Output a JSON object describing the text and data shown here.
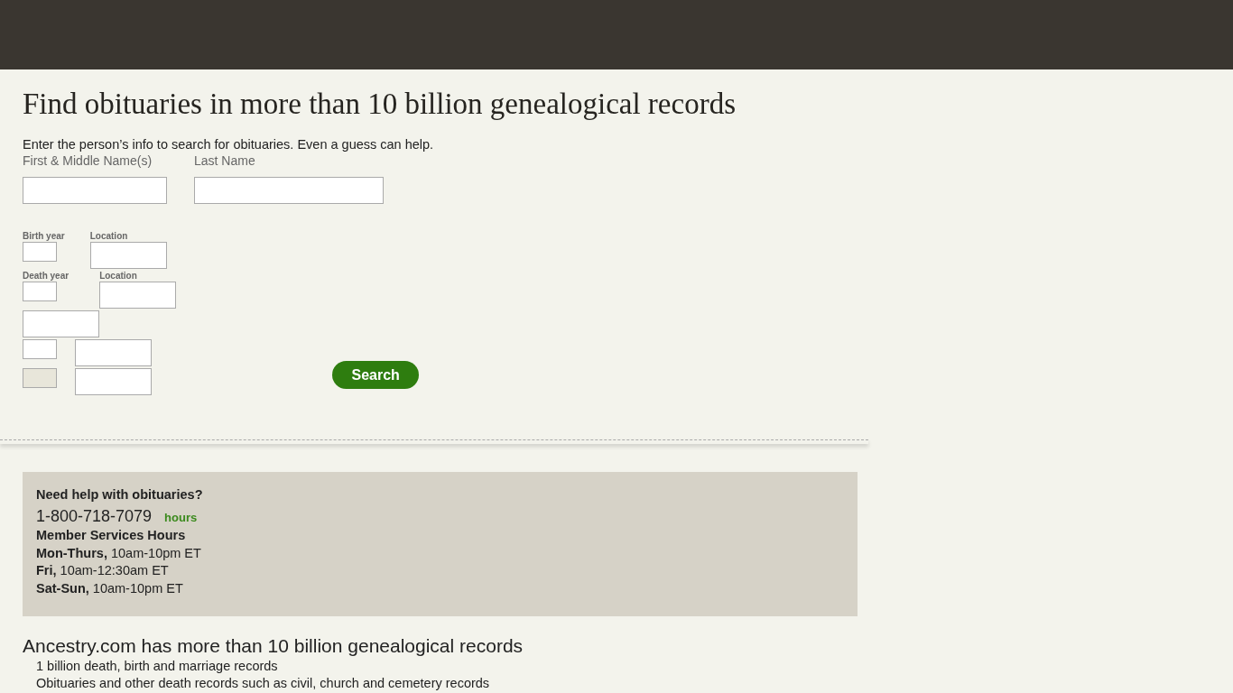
{
  "heading": "Find obituaries in more than 10 billion genealogical records",
  "intro": "Enter the person’s info to search for obituaries. Even a guess can help.",
  "name_fields": [
    {
      "label": "First & Middle Name(s)",
      "kind": "first"
    },
    {
      "label": "Last Name",
      "kind": "last"
    }
  ],
  "date_rows": [
    {
      "fields": [
        {
          "label": "Birth year",
          "kind": "year",
          "disabled": false
        },
        {
          "label": "Location",
          "kind": "place",
          "disabled": false
        }
      ]
    },
    {
      "fields": [
        {
          "label": "Death year",
          "kind": "year",
          "disabled": false
        },
        {
          "label": "Location",
          "kind": "place",
          "disabled": false
        }
      ]
    },
    {
      "fields": [
        {
          "kind": "place",
          "disabled": false
        }
      ]
    },
    {
      "fields": [
        {
          "kind": "year",
          "disabled": false
        },
        {
          "kind": "place",
          "disabled": false
        }
      ]
    },
    {
      "fields": [
        {
          "kind": "year",
          "disabled": true
        },
        {
          "kind": "place",
          "disabled": false
        }
      ]
    }
  ],
  "search_button": "Search",
  "help": {
    "title": "Need help with obituaries?",
    "phone": "1-800-718-7079",
    "hours_link": "hours",
    "hours_title": "Member Services Hours",
    "hours": [
      "**Mon-Thurs,** 10am-10pm ET",
      "**Fri,** 10am-12:30am ET",
      "**Sat-Sun,** 10am-10pm ET"
    ]
  },
  "records": {
    "title": "Ancestry.com has more than 10 billion genealogical records",
    "items": [
      "1 billion death, birth and marriage records",
      "Obituaries and other death records such as civil, church and cemetery records"
    ]
  }
}
